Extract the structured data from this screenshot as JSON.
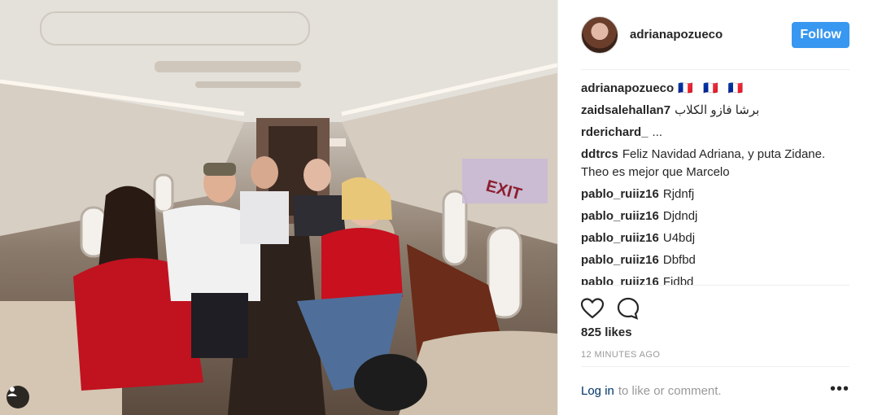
{
  "post": {
    "username": "adrianapozueco",
    "follow_label": "Follow",
    "likes": "825 likes",
    "time_ago": "12 MINUTES AGO",
    "login_link": "Log in",
    "login_rest": "to like or comment.",
    "more": "•••"
  },
  "comments": [
    {
      "user": "adrianapozueco",
      "text": "🇫🇷 🇫🇷 🇫🇷"
    },
    {
      "user": "zaidsalehallan7",
      "text": "برشا فازو الكلاب"
    },
    {
      "user": "rderichard_",
      "text": "..."
    },
    {
      "user": "ddtrcs",
      "text": "Feliz Navidad Adriana, y puta Zidane. Theo es mejor que Marcelo"
    },
    {
      "user": "pablo_ruiiz16",
      "text": "Rjdnfj"
    },
    {
      "user": "pablo_ruiiz16",
      "text": "Djdndj"
    },
    {
      "user": "pablo_ruiiz16",
      "text": "U4bdj"
    },
    {
      "user": "pablo_ruiiz16",
      "text": "Dbfbd"
    },
    {
      "user": "pablo_ruiiz16",
      "text": "Fjdbd"
    }
  ],
  "icons": {
    "like": "heart-icon",
    "comment": "comment-icon",
    "user_tag": "user-tag-icon"
  },
  "colors": {
    "follow_button": "#3897f0",
    "link": "#003569"
  }
}
